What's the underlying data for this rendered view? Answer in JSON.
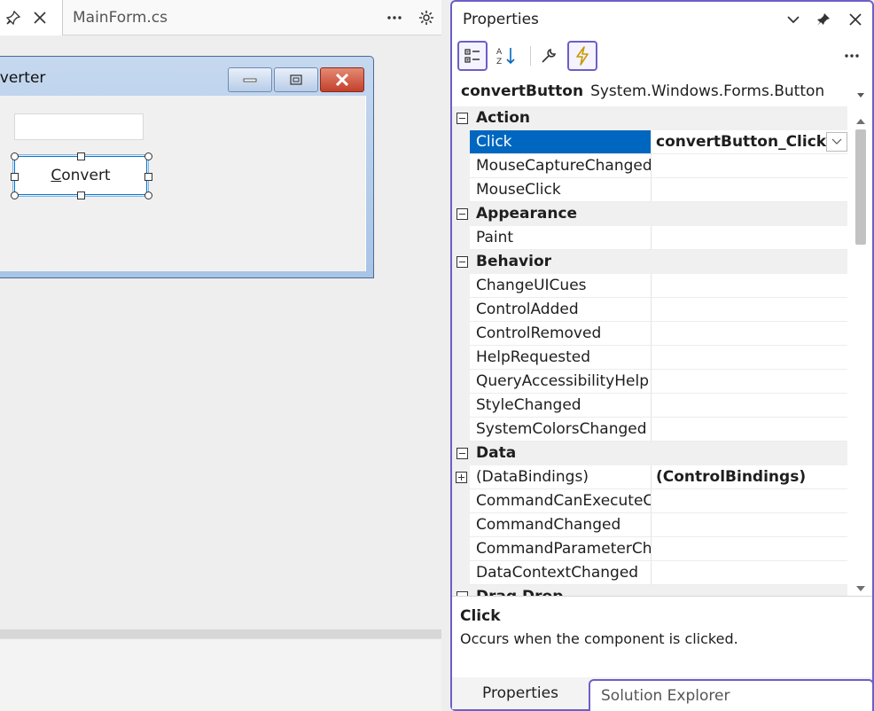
{
  "designer": {
    "active_tab_label": "",
    "tabs": [
      {
        "label": "MainForm.cs"
      }
    ],
    "form": {
      "title": "nverter",
      "button_label_mnemonic": "C",
      "button_label_rest": "onvert"
    }
  },
  "properties": {
    "header_title": "Properties",
    "object_name": "convertButton",
    "object_type": "System.Windows.Forms.Button",
    "toolbar": {
      "categorized": "categorized-icon",
      "alphabetical": "sort-az-icon",
      "properties": "wrench-icon",
      "events": "lightning-icon"
    },
    "rows": [
      {
        "kind": "category",
        "label": "Action"
      },
      {
        "kind": "prop",
        "name": "Click",
        "value": "convertButton_Click",
        "selected": true,
        "dropdown": true
      },
      {
        "kind": "prop",
        "name": "MouseCaptureChanged",
        "value": ""
      },
      {
        "kind": "prop",
        "name": "MouseClick",
        "value": ""
      },
      {
        "kind": "category",
        "label": "Appearance"
      },
      {
        "kind": "prop",
        "name": "Paint",
        "value": ""
      },
      {
        "kind": "category",
        "label": "Behavior"
      },
      {
        "kind": "prop",
        "name": "ChangeUICues",
        "value": ""
      },
      {
        "kind": "prop",
        "name": "ControlAdded",
        "value": ""
      },
      {
        "kind": "prop",
        "name": "ControlRemoved",
        "value": ""
      },
      {
        "kind": "prop",
        "name": "HelpRequested",
        "value": ""
      },
      {
        "kind": "prop",
        "name": "QueryAccessibilityHelp",
        "value": ""
      },
      {
        "kind": "prop",
        "name": "StyleChanged",
        "value": ""
      },
      {
        "kind": "prop",
        "name": "SystemColorsChanged",
        "value": ""
      },
      {
        "kind": "category",
        "label": "Data"
      },
      {
        "kind": "prop",
        "name": "(DataBindings)",
        "value": "(ControlBindings)",
        "expandable": true
      },
      {
        "kind": "prop",
        "name": "CommandCanExecuteChanged",
        "value": ""
      },
      {
        "kind": "prop",
        "name": "CommandChanged",
        "value": ""
      },
      {
        "kind": "prop",
        "name": "CommandParameterChanged",
        "value": ""
      },
      {
        "kind": "prop",
        "name": "DataContextChanged",
        "value": ""
      },
      {
        "kind": "category",
        "label": "Drag Drop"
      }
    ],
    "description": {
      "title": "Click",
      "text": "Occurs when the component is clicked."
    },
    "bottom_tabs": [
      {
        "label": "Properties"
      },
      {
        "label": "Solution Explorer"
      }
    ]
  }
}
